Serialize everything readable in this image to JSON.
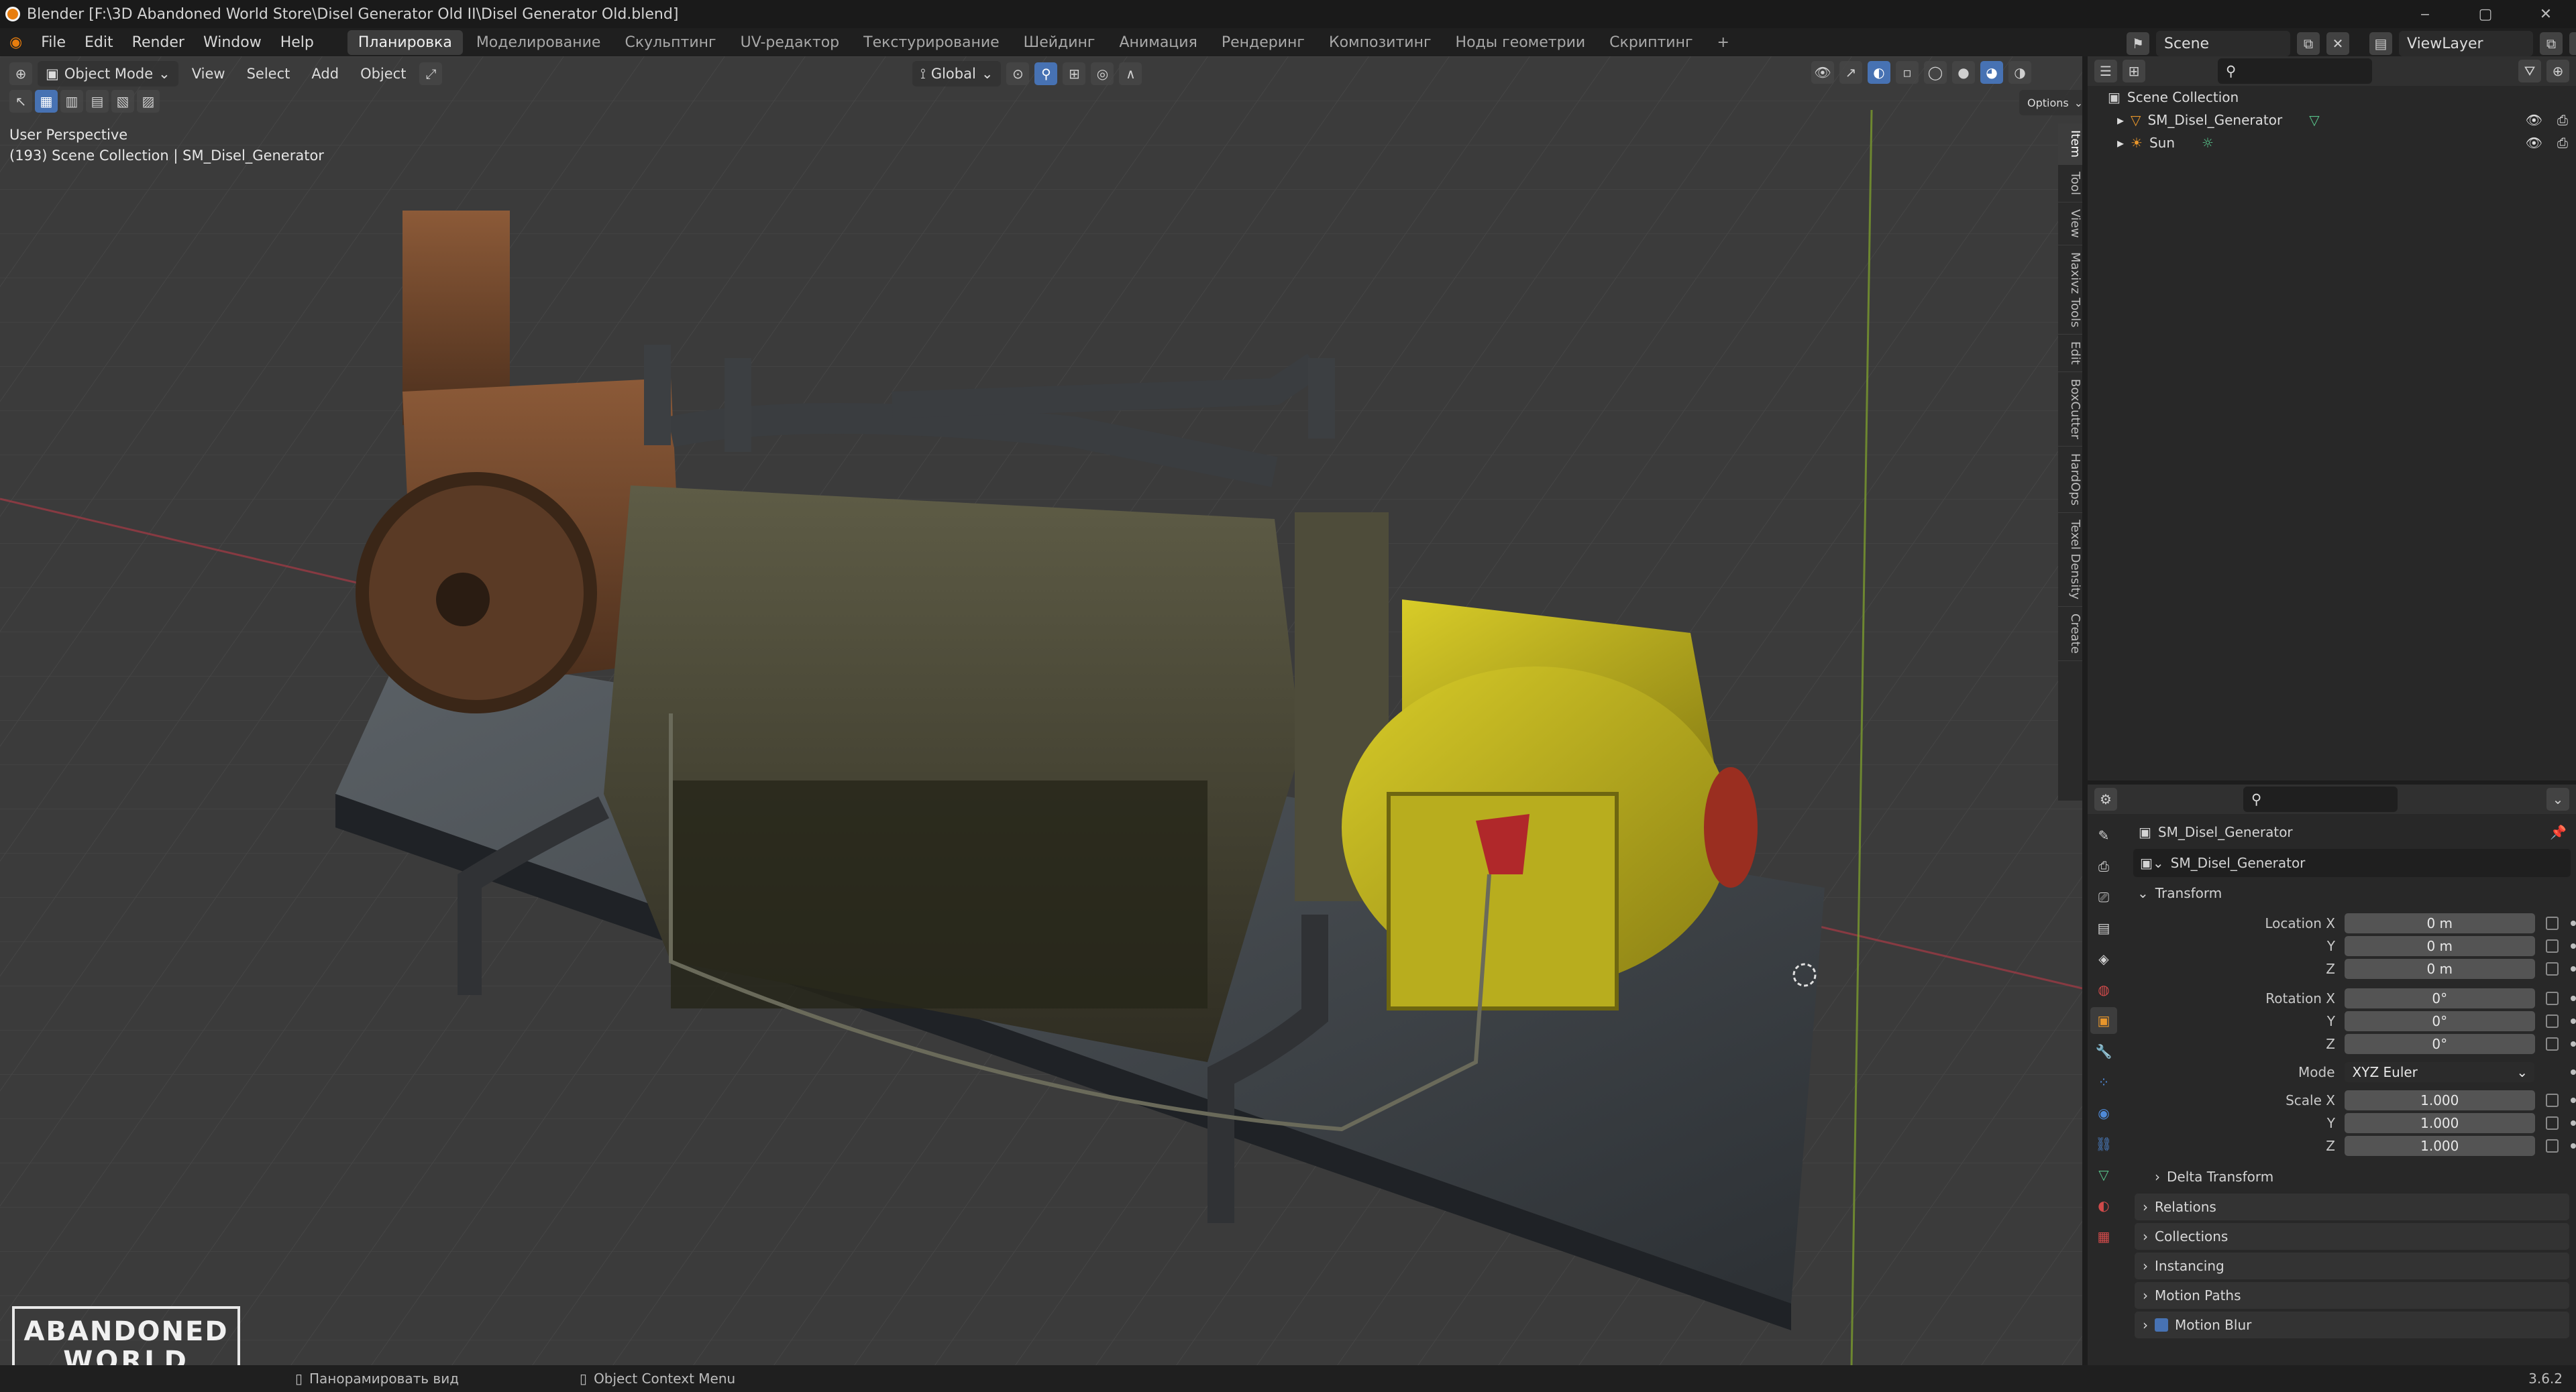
{
  "window": {
    "title": "Blender [F:\\3D Abandoned World Store\\Disel Generator Old II\\Disel Generator Old.blend]",
    "min": "‒",
    "max": "▢",
    "close": "✕"
  },
  "menu": [
    "File",
    "Edit",
    "Render",
    "Window",
    "Help"
  ],
  "workspaces": [
    "Планировка",
    "Моделирование",
    "Скульптинг",
    "UV-редактор",
    "Текстурирование",
    "Шейдинг",
    "Анимация",
    "Рендеринг",
    "Композитинг",
    "Ноды геометрии",
    "Скриптинг"
  ],
  "workspace_add": "+",
  "scene_name": "Scene",
  "view_layer": "ViewLayer",
  "viewport": {
    "mode": "Object Mode",
    "menus": [
      "View",
      "Select",
      "Add",
      "Object"
    ],
    "transform_orientation": "Global",
    "options_label": "Options",
    "perspective": "User Perspective",
    "collection_info": "(193) Scene Collection | SM_Disel_Generator",
    "side_tabs": [
      "Item",
      "Tool",
      "View",
      "Maxivz Tools",
      "Edit",
      "BoxCutter",
      "HardOps",
      "Texel Density",
      "Create"
    ],
    "logo_line1": "ABANDONED",
    "logo_line2": "WORLD"
  },
  "outliner": {
    "root": "Scene Collection",
    "items": [
      {
        "name": "SM_Disel_Generator",
        "icon": "mesh-object-icon"
      },
      {
        "name": "Sun",
        "icon": "sun-light-icon"
      }
    ]
  },
  "properties": {
    "object_name": "SM_Disel_Generator",
    "datablock_name": "SM_Disel_Generator",
    "transform_header": "Transform",
    "location_label": "Location X",
    "y_label": "Y",
    "z_label": "Z",
    "rotation_label": "Rotation X",
    "mode_label": "Mode",
    "scale_label": "Scale X",
    "location": [
      "0 m",
      "0 m",
      "0 m"
    ],
    "rotation": [
      "0°",
      "0°",
      "0°"
    ],
    "mode": "XYZ Euler",
    "scale": [
      "1.000",
      "1.000",
      "1.000"
    ],
    "panels": [
      "Delta Transform",
      "Relations",
      "Collections",
      "Instancing",
      "Motion Paths",
      "Motion Blur"
    ]
  },
  "status": {
    "left": "Панорамировать вид",
    "middle": "Object Context Menu",
    "version": "3.6.2"
  },
  "colors": {
    "accent": "#4772b3",
    "blender_orange": "#e87d0d",
    "x_axis": "#a83a45",
    "y_axis": "#7a9a2e"
  }
}
